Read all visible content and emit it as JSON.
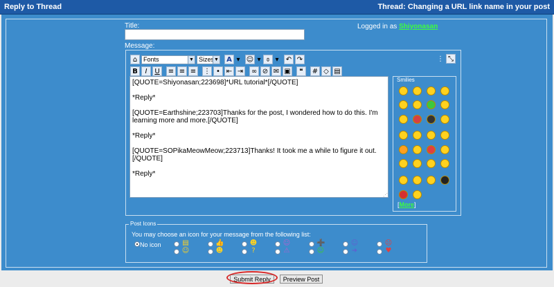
{
  "window": {
    "title": "Reply to Thread",
    "thread_label": "Thread: Changing a URL link name in your post"
  },
  "form": {
    "title_label": "Title:",
    "message_label": "Message:",
    "logged_in_prefix": "Logged in as",
    "username": "Shiyonasan"
  },
  "toolbar": {
    "font_select": "Fonts",
    "size_select": "Sizes",
    "row1_icons": [
      "home-icon",
      "font-color-icon",
      "smiley-icon",
      "attachment-icon",
      "undo-icon",
      "redo-icon"
    ],
    "row2_icons": [
      "bold-icon",
      "italic-icon",
      "underline-icon",
      "align-left-icon",
      "align-center-icon",
      "align-right-icon",
      "ordered-list-icon",
      "unordered-list-icon",
      "outdent-icon",
      "indent-icon",
      "link-icon",
      "unlink-icon",
      "email-icon",
      "image-icon",
      "quote-icon",
      "code-icon",
      "html-icon",
      "php-icon"
    ]
  },
  "message": {
    "paragraphs": [
      "[QUOTE=Shiyonasan;223698]*URL tutorial*[/QUOTE]",
      "*Reply*",
      "[QUOTE=Earthshine;223703]Thanks for the post, I wondered how to do this. I'm learning more and more.[/QUOTE]",
      "*Reply*",
      "[QUOTE=SOPikaMeowMeow;223713]Thanks! It took me a while to figure it out.[/QUOTE]",
      "*Reply*"
    ]
  },
  "smilies": {
    "legend": "Smilies",
    "more_left": "[",
    "more_link": "More",
    "more_right": "]"
  },
  "post_icons": {
    "legend": "Post Icons",
    "description": "You may choose an icon for your message from the following list:",
    "no_icon_label": "No icon"
  },
  "buttons": {
    "submit": "Submit Reply",
    "preview": "Preview Post"
  },
  "colors": {
    "title_bar": "#1e5aa6",
    "panel": "#3d8ccc",
    "username": "#3cff3c",
    "highlight_ring": "#d62828"
  }
}
